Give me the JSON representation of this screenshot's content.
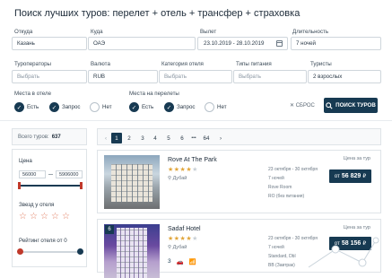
{
  "page_title": "Поиск лучших туров: перелет + отель + трансфер + страховка",
  "form": {
    "from_label": "Откуда",
    "from_value": "Казань",
    "to_label": "Куда",
    "to_value": "ОАЭ",
    "depart_label": "Вылет",
    "depart_value": "23.10.2019 - 28.10.2019",
    "duration_label": "Длительность",
    "duration_value": "7 ночей",
    "operators_label": "Туроператоры",
    "operators_placeholder": "Выбрать",
    "currency_label": "Валюта",
    "currency_value": "RUB",
    "hotel_cat_label": "Категория отеля",
    "hotel_cat_placeholder": "Выбрать",
    "meal_label": "Типы питания",
    "meal_placeholder": "Выбрать",
    "tourists_label": "Туристы",
    "tourists_value": "2 взрослых"
  },
  "hotel_seats": {
    "label": "Места в отеле",
    "options": [
      {
        "label": "Есть",
        "checked": true
      },
      {
        "label": "Запрос",
        "checked": true
      },
      {
        "label": "Нет",
        "checked": false
      }
    ]
  },
  "flight_seats": {
    "label": "Места на перелеты",
    "options": [
      {
        "label": "Есть",
        "checked": true
      },
      {
        "label": "Запрос",
        "checked": true
      },
      {
        "label": "Нет",
        "checked": false
      }
    ]
  },
  "reset_label": "СБРОС",
  "search_button": "ПОИСК ТУРОВ",
  "total": {
    "label": "Всего туров:",
    "value": "637"
  },
  "filters": {
    "price_label": "Цена",
    "price_min": "56000",
    "price_max": "5906000",
    "stars_label": "Звезд у отеля",
    "rating_label": "Рейтинг отеля от 0"
  },
  "pager": {
    "prev": "‹",
    "pages": [
      "1",
      "2",
      "3",
      "4",
      "5",
      "6",
      "•••",
      "64"
    ],
    "next": "›",
    "active_page": "1"
  },
  "hotels": [
    {
      "name": "Rove At The Park",
      "stars": 4,
      "location": "Дубай",
      "dates": "23 октября - 30 октября",
      "nights": "7 ночей",
      "room": "Rove Room",
      "meal": "RO (без питания)",
      "price_label": "Цена за тур",
      "price_prefix": "от",
      "price": "56 829",
      "currency": "₽"
    },
    {
      "badge": "6",
      "name": "Sadaf Hotel",
      "stars": 4,
      "location": "Дубай",
      "dates": "23 октября - 30 октября",
      "nights": "7 ночей",
      "room": "Standard, Dbl",
      "meal": "BB (Завтрак)",
      "price_label": "Цена за тур",
      "price_prefix": "от",
      "price": "58 156",
      "currency": "₽",
      "amenities": [
        "3",
        "🚗",
        "📶"
      ]
    }
  ],
  "icons": {
    "calendar": "calendar-icon",
    "search": "search-icon",
    "close": "close-icon",
    "location": "location-pin-icon",
    "check": "check-icon",
    "star": "star-outline-icon"
  },
  "colors": {
    "primary": "#173a52",
    "star": "#e0a53a",
    "star_outline": "#e07b5e",
    "slider_handle": "#c0392b"
  }
}
